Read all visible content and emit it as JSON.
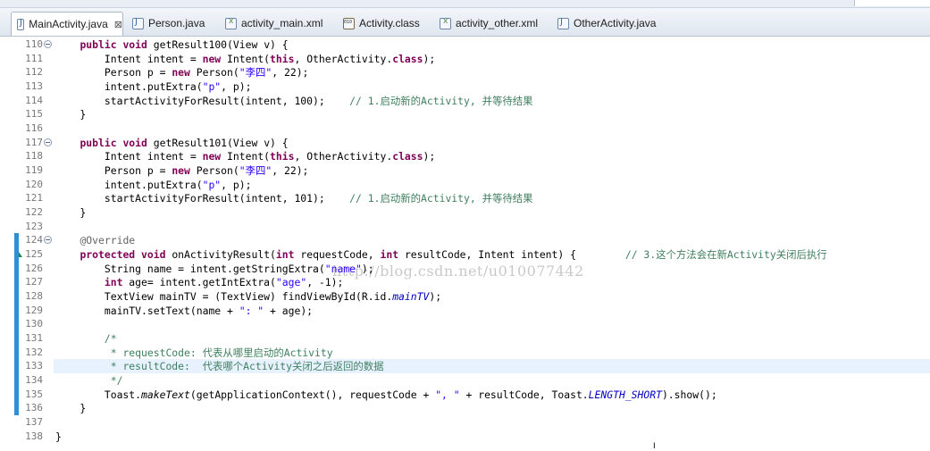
{
  "tabs": [
    {
      "label": "MainActivity.java",
      "icon": "java-file-icon",
      "active": true,
      "closable": true
    },
    {
      "label": "Person.java",
      "icon": "java-file-icon"
    },
    {
      "label": "activity_main.xml",
      "icon": "xml-file-icon"
    },
    {
      "label": "Activity.class",
      "icon": "class-file-icon"
    },
    {
      "label": "activity_other.xml",
      "icon": "xml-file-icon"
    },
    {
      "label": "OtherActivity.java",
      "icon": "java-file-icon"
    }
  ],
  "close_glyph": "⊠",
  "watermark": "http://blog.csdn.net/u010077442",
  "editor": {
    "lines": [
      {
        "n": "110",
        "fold": true,
        "spans": [
          [
            "    "
          ],
          [
            "public",
            "kw"
          ],
          [
            " "
          ],
          [
            "void",
            "kw"
          ],
          [
            " getResult100(View v) {"
          ]
        ]
      },
      {
        "n": "111",
        "spans": [
          [
            "        Intent intent = "
          ],
          [
            "new",
            "kw"
          ],
          [
            " Intent("
          ],
          [
            "this",
            "kw"
          ],
          [
            ", OtherActivity."
          ],
          [
            "class",
            "kw"
          ],
          [
            ");"
          ]
        ]
      },
      {
        "n": "112",
        "spans": [
          [
            "        Person p = "
          ],
          [
            "new",
            "kw"
          ],
          [
            " Person("
          ],
          [
            "\"李四\"",
            "str"
          ],
          [
            ", 22);"
          ]
        ]
      },
      {
        "n": "113",
        "spans": [
          [
            "        intent.putExtra("
          ],
          [
            "\"p\"",
            "str"
          ],
          [
            ", p);"
          ]
        ]
      },
      {
        "n": "114",
        "spans": [
          [
            "        startActivityForResult(intent, 100);    "
          ],
          [
            "// 1.启动新的Activity, 并等待结果",
            "cm"
          ]
        ]
      },
      {
        "n": "115",
        "spans": [
          [
            "    }"
          ]
        ]
      },
      {
        "n": "116",
        "spans": [
          [
            ""
          ]
        ]
      },
      {
        "n": "117",
        "fold": true,
        "spans": [
          [
            "    "
          ],
          [
            "public",
            "kw"
          ],
          [
            " "
          ],
          [
            "void",
            "kw"
          ],
          [
            " getResult101(View v) {"
          ]
        ]
      },
      {
        "n": "118",
        "spans": [
          [
            "        Intent intent = "
          ],
          [
            "new",
            "kw"
          ],
          [
            " Intent("
          ],
          [
            "this",
            "kw"
          ],
          [
            ", OtherActivity."
          ],
          [
            "class",
            "kw"
          ],
          [
            ");"
          ]
        ]
      },
      {
        "n": "119",
        "spans": [
          [
            "        Person p = "
          ],
          [
            "new",
            "kw"
          ],
          [
            " Person("
          ],
          [
            "\"李四\"",
            "str"
          ],
          [
            ", 22);"
          ]
        ]
      },
      {
        "n": "120",
        "spans": [
          [
            "        intent.putExtra("
          ],
          [
            "\"p\"",
            "str"
          ],
          [
            ", p);"
          ]
        ]
      },
      {
        "n": "121",
        "spans": [
          [
            "        startActivityForResult(intent, 101);    "
          ],
          [
            "// 1.启动新的Activity, 并等待结果",
            "cm"
          ]
        ]
      },
      {
        "n": "122",
        "spans": [
          [
            "    }"
          ]
        ]
      },
      {
        "n": "123",
        "spans": [
          [
            ""
          ]
        ]
      },
      {
        "n": "124",
        "fold": true,
        "spans": [
          [
            "    "
          ],
          [
            "@Override",
            "ann"
          ]
        ]
      },
      {
        "n": "125",
        "override": true,
        "spans": [
          [
            "    "
          ],
          [
            "protected",
            "kw"
          ],
          [
            " "
          ],
          [
            "void",
            "kw"
          ],
          [
            " onActivityResult("
          ],
          [
            "int",
            "kw"
          ],
          [
            " requestCode, "
          ],
          [
            "int",
            "kw"
          ],
          [
            " resultCode, Intent intent) {        "
          ],
          [
            "// 3.这个方法会在新Activity关闭后执行",
            "cm"
          ]
        ]
      },
      {
        "n": "126",
        "spans": [
          [
            "        String name = intent.getStringExtra("
          ],
          [
            "\"name\"",
            "str"
          ],
          [
            ");"
          ]
        ]
      },
      {
        "n": "127",
        "spans": [
          [
            "        "
          ],
          [
            "int",
            "kw"
          ],
          [
            " age= intent.getIntExtra("
          ],
          [
            "\"age\"",
            "str"
          ],
          [
            ", -1);"
          ]
        ]
      },
      {
        "n": "128",
        "spans": [
          [
            "        TextView mainTV = (TextView) findViewById(R.id."
          ],
          [
            "mainTV",
            "it"
          ],
          [
            ");"
          ]
        ]
      },
      {
        "n": "129",
        "spans": [
          [
            "        mainTV.setText(name + "
          ],
          [
            "\": \"",
            "str"
          ],
          [
            " + age);"
          ]
        ]
      },
      {
        "n": "130",
        "spans": [
          [
            ""
          ]
        ]
      },
      {
        "n": "131",
        "spans": [
          [
            "        "
          ],
          [
            "/*",
            "cm"
          ]
        ]
      },
      {
        "n": "132",
        "spans": [
          [
            "        "
          ],
          [
            " * requestCode: 代表从哪里启动的Activity",
            "cm"
          ]
        ]
      },
      {
        "n": "133",
        "highlight": true,
        "spans": [
          [
            "        "
          ],
          [
            " * resultCode:  代表哪个Activity关闭之后返回的数据",
            "cm"
          ]
        ]
      },
      {
        "n": "134",
        "spans": [
          [
            "        "
          ],
          [
            " */",
            "cm"
          ]
        ]
      },
      {
        "n": "135",
        "spans": [
          [
            "        Toast."
          ],
          [
            "makeText",
            "it2"
          ],
          [
            "(getApplicationContext(), requestCode + "
          ],
          [
            "\", \"",
            "str"
          ],
          [
            " + resultCode, Toast."
          ],
          [
            "LENGTH_SHORT",
            "it"
          ],
          [
            ").show();"
          ]
        ]
      },
      {
        "n": "136",
        "spans": [
          [
            "    }"
          ]
        ]
      },
      {
        "n": "137",
        "spans": [
          [
            ""
          ]
        ]
      },
      {
        "n": "138",
        "spans": [
          [
            "}"
          ]
        ]
      }
    ]
  }
}
